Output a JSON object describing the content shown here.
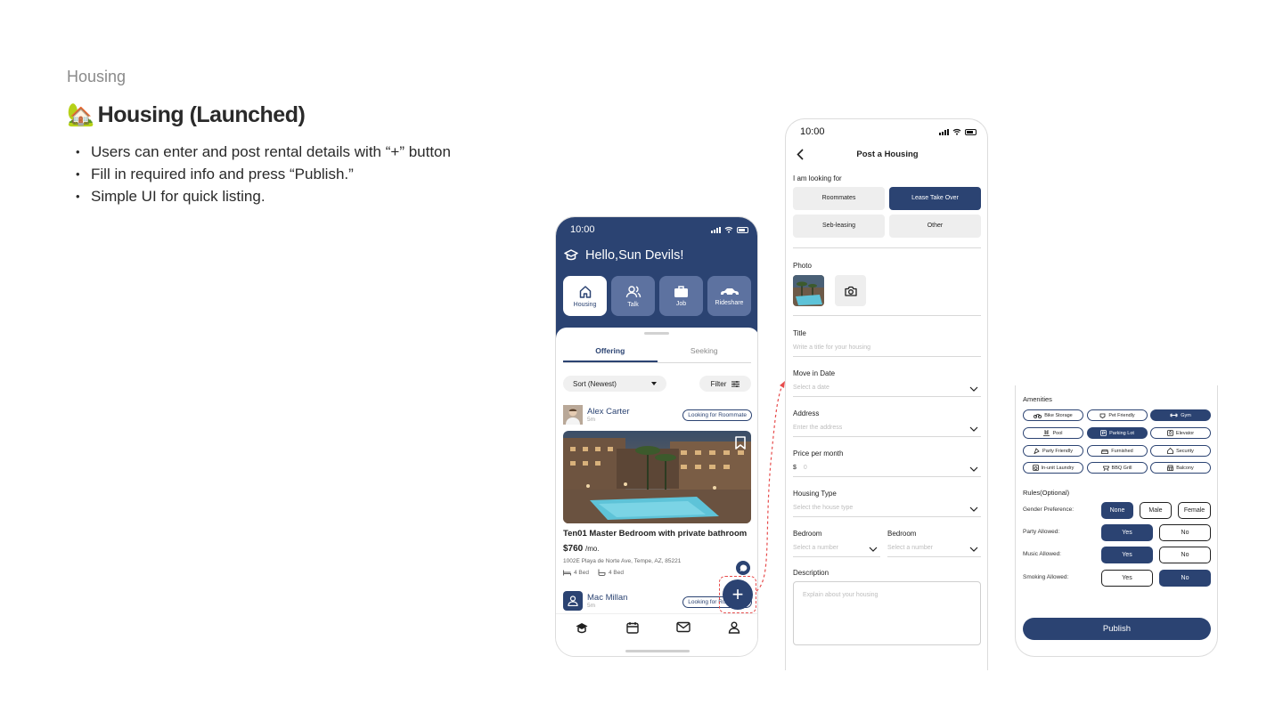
{
  "header": {
    "section_label": "Housing",
    "title_emoji": "🏡",
    "title": "Housing (Launched)",
    "bullets": [
      "Users can enter and post rental details with “+” button",
      "Fill in required info and press “Publish.”",
      "Simple UI for quick listing."
    ]
  },
  "colors": {
    "primary": "#2b4372",
    "accent_red": "#e74c4c",
    "chip_bg": "#eeeeee"
  },
  "feed_screen": {
    "time": "10:00",
    "greeting": "Hello,Sun Devils!",
    "categories": [
      {
        "label": "Housing",
        "icon": "home-icon",
        "active": true
      },
      {
        "label": "Talk",
        "icon": "people-icon",
        "active": false
      },
      {
        "label": "Job",
        "icon": "briefcase-icon",
        "active": false
      },
      {
        "label": "Rideshare",
        "icon": "car-icon",
        "active": false
      }
    ],
    "tabs": {
      "offering": "Offering",
      "seeking": "Seeking"
    },
    "sort_label": "Sort (Newest)",
    "filter_label": "Filter",
    "posts": [
      {
        "user": "Alex Carter",
        "time": "5m",
        "tag": "Looking for Roommate",
        "title": "Ten01 Master Bedroom with private bathroom",
        "price": "$760",
        "price_unit": "/mo.",
        "address": "1002E Playa de Norte Ave, Tempe, AZ, 85221",
        "beds": "4 Bed",
        "baths": "4 Bed"
      },
      {
        "user": "Mac Millan",
        "time": "5m",
        "tag": "Looking for Roommate"
      }
    ],
    "fab_label": "+",
    "tabbar_icons": [
      "graduation-cap-icon",
      "calendar-icon",
      "mail-icon",
      "profile-icon"
    ]
  },
  "post_screen": {
    "time": "10:00",
    "title": "Post a Housing",
    "looking_for_label": "I am looking for",
    "looking_for_options": [
      {
        "label": "Roommates",
        "active": false
      },
      {
        "label": "Lease Take Over",
        "active": true
      },
      {
        "label": "Seb-leasing",
        "active": false
      },
      {
        "label": "Other",
        "active": false
      }
    ],
    "photo_label": "Photo",
    "title_label": "Title",
    "title_placeholder": "Write a title for your housing",
    "move_in_label": "Move in Date",
    "move_in_placeholder": "Select a date",
    "address_label": "Address",
    "address_placeholder": "Enter the address",
    "price_label": "Price per month",
    "price_currency": "$",
    "price_placeholder": "0",
    "housing_type_label": "Housing Type",
    "housing_type_placeholder": "Select the house type",
    "bedroom_label_1": "Bedroom",
    "bedroom_placeholder_1": "Select a number",
    "bedroom_label_2": "Bedroom",
    "bedroom_placeholder_2": "Select a number",
    "description_label": "Description",
    "description_placeholder": "Explain about your housing"
  },
  "details_screen": {
    "amenities_label": "Amenities",
    "amenities": [
      {
        "label": "Bike Storage",
        "on": false
      },
      {
        "label": "Pet Friendly",
        "on": false
      },
      {
        "label": "Gym",
        "on": true
      },
      {
        "label": "Pool",
        "on": false
      },
      {
        "label": "Parking Lot",
        "on": true
      },
      {
        "label": "Elevator",
        "on": false
      },
      {
        "label": "Party Friendly",
        "on": false
      },
      {
        "label": "Furnished",
        "on": false
      },
      {
        "label": "Security",
        "on": false
      },
      {
        "label": "In-unit Laundry",
        "on": false
      },
      {
        "label": "BBQ Grill",
        "on": false
      },
      {
        "label": "Balcony",
        "on": false
      }
    ],
    "rules_label": "Rules(Optional)",
    "gender_label": "Gender Preference:",
    "gender_options": [
      {
        "label": "None",
        "on": true
      },
      {
        "label": "Male",
        "on": false
      },
      {
        "label": "Female",
        "on": false
      }
    ],
    "party_label": "Party Allowed:",
    "party_options": [
      {
        "label": "Yes",
        "on": true
      },
      {
        "label": "No",
        "on": false
      }
    ],
    "music_label": "Music Allowed:",
    "music_options": [
      {
        "label": "Yes",
        "on": true
      },
      {
        "label": "No",
        "on": false
      }
    ],
    "smoking_label": "Smoking Allowed:",
    "smoking_options": [
      {
        "label": "Yes",
        "on": false
      },
      {
        "label": "No",
        "on": true
      }
    ],
    "publish_label": "Publish"
  }
}
